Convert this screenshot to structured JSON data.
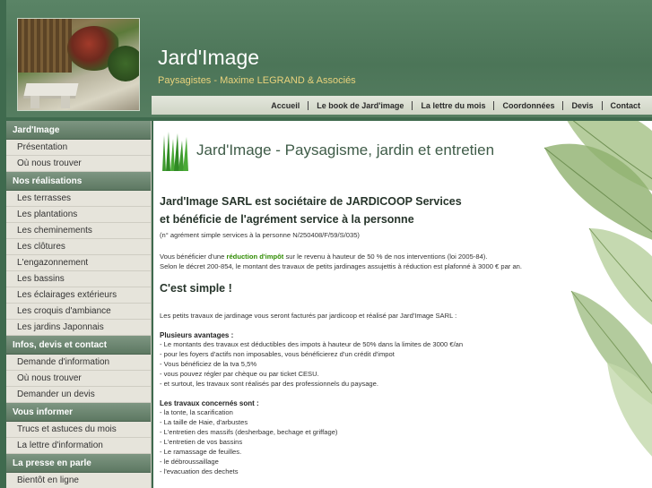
{
  "header": {
    "title": "Jard'Image",
    "subtitle": "Paysagistes - Maxime LEGRAND & Associés"
  },
  "nav": [
    "Accueil",
    "Le book de Jard'image",
    "La lettre du mois",
    "Coordonnées",
    "Devis",
    "Contact"
  ],
  "sidebar": [
    {
      "heading": "Jard'Image",
      "items": [
        "Présentation",
        "Où nous trouver"
      ]
    },
    {
      "heading": "Nos réalisations",
      "items": [
        "Les terrasses",
        "Les plantations",
        "Les cheminements",
        "Les clôtures",
        "L'engazonnement",
        "Les bassins",
        "Les éclairages extérieurs",
        "Les croquis d'ambiance",
        "Les jardins Japonnais"
      ]
    },
    {
      "heading": "Infos, devis et contact",
      "items": [
        "Demande d'information",
        "Où nous trouver",
        "Demander un devis"
      ]
    },
    {
      "heading": "Vous informer",
      "items": [
        "Trucs et astuces du mois",
        "La lettre d'information"
      ]
    },
    {
      "heading": "La presse en parle",
      "items": [
        "Bientôt en ligne"
      ]
    }
  ],
  "main": {
    "heading": "Jard'Image - Paysagisme, jardin et entretien",
    "intro_line1": "Jard'Image SARL est sociétaire de JARDICOOP Services",
    "intro_line2": "et bénéficie de l'agrément service à la personne",
    "agrement": "(n° agrément simple services à la personne N/250408/F/59/S/035)",
    "benefit_pre": "Vous bénéficier d'une ",
    "benefit_highlight": "réduction d'impôt",
    "benefit_post": " sur le revenu à hauteur de 50 % de nos interventions (loi 2005-84).",
    "decree": "Selon le décret 200-854, le montant des travaux de petits jardinages assujettis à réduction est plafonné à 3000 € par an.",
    "simple_heading": "C'est simple !",
    "simple_text": "Les petits travaux de jardinage vous seront facturés par jardicoop et réalisé par Jard'Image SARL :",
    "advantages_heading": "Plusieurs avantages :",
    "advantages": [
      "- Le montants des travaux est déductibles des impots à hauteur de 50% dans la limites de 3000 €/an",
      "- pour les foyers d'actifs non imposables, vous bénéficierez d'un crédit d'impot",
      "- Vous bénéficiez de la tva 5,5%",
      "- vous pouvez régler par chèque ou par ticket CESU.",
      "- et surtout, les travaux sont réalisés par des professionnels du paysage."
    ],
    "works_heading": "Les travaux concernés sont :",
    "works": [
      "- la tonte, la scarification",
      "- La taille de Haie, d'arbustes",
      "- L'entretien des massifs (desherbage, bechage et griffage)",
      "- L'entretien de vos bassins",
      "- Le ramassage de feuilles.",
      "- le débroussaillage",
      "- l'evacuation des dechets"
    ]
  },
  "colors": {
    "header_bg": "#4c7558",
    "subtitle": "#e9d27c",
    "sidebar_heading": "#5d7862",
    "highlight_green": "#2e8b00"
  }
}
